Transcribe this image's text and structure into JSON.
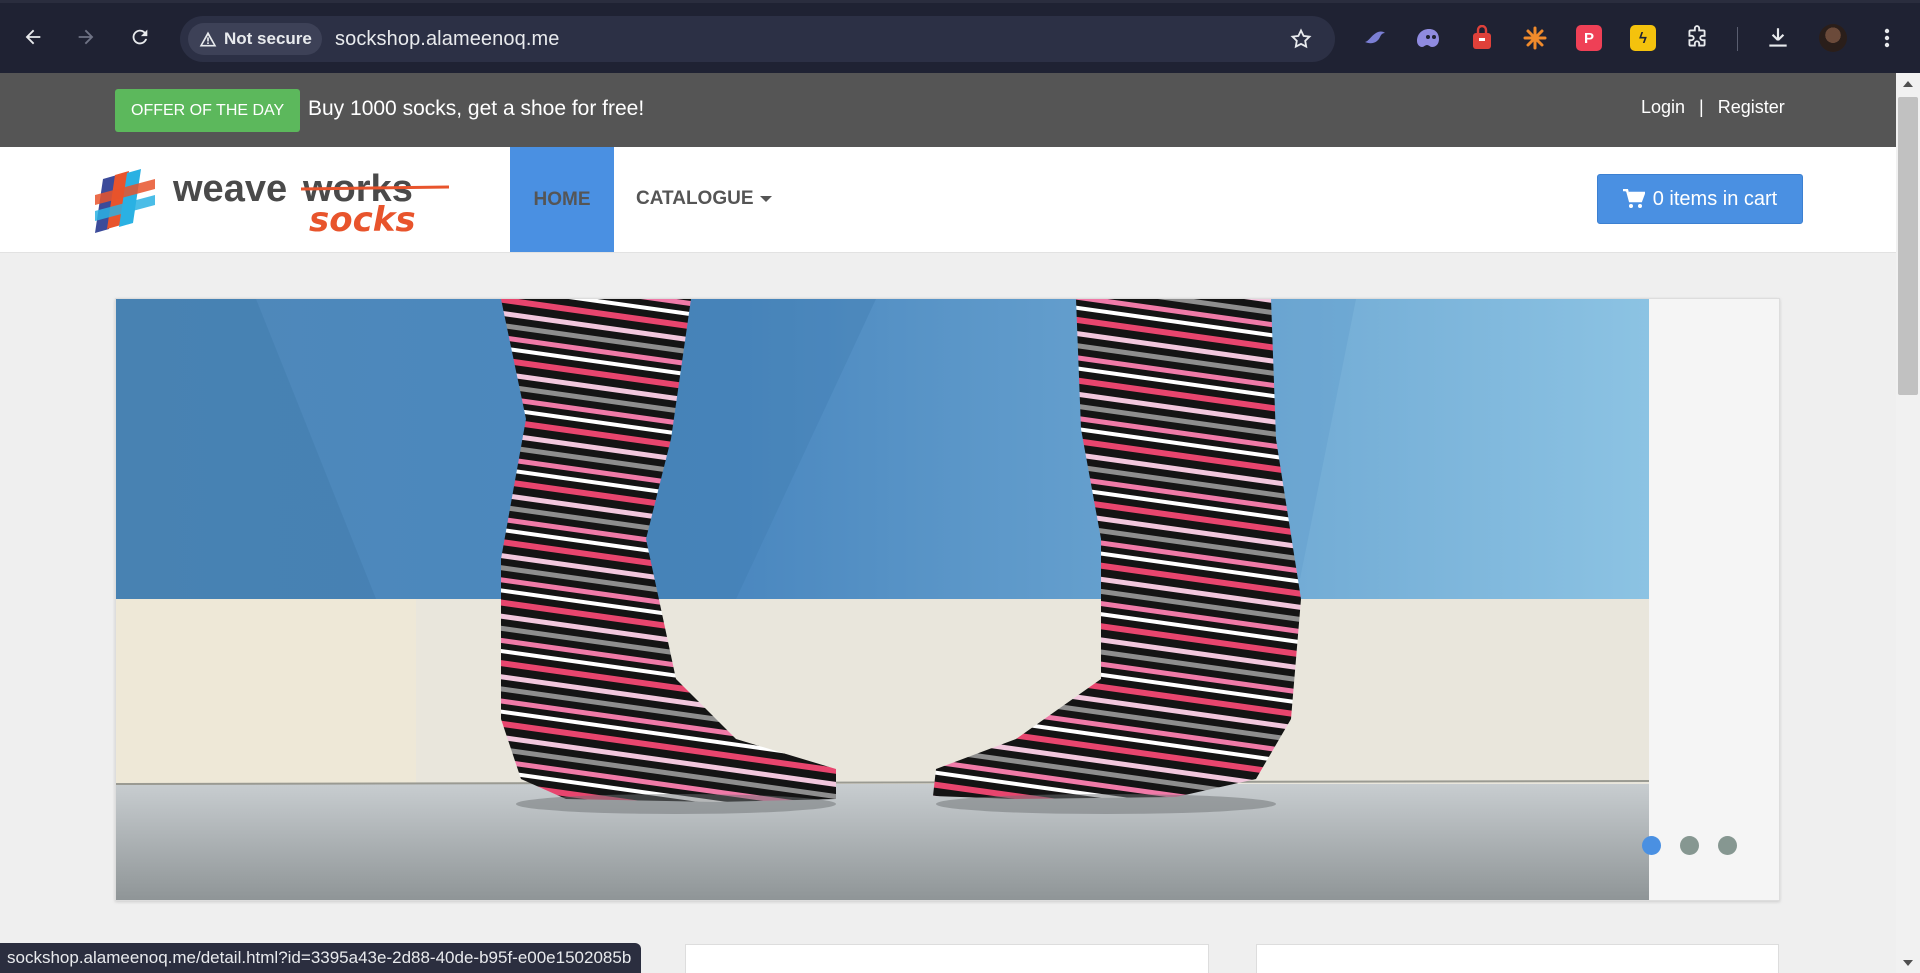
{
  "browser": {
    "security_label": "Not secure",
    "url": "sockshop.alameenoq.me",
    "status_url": "sockshop.alameenoq.me/detail.html?id=3395a43e-2d88-40de-b95f-e00e1502085b",
    "extensions": [
      {
        "name": "extension-bird-icon",
        "color": "#7b7fd4"
      },
      {
        "name": "extension-ghost-icon",
        "color": "#8f8be0"
      },
      {
        "name": "extension-bag-icon",
        "color": "#e0413a"
      },
      {
        "name": "extension-spark-icon",
        "color": "#f08a2b"
      },
      {
        "name": "extension-pocket-icon",
        "color": "#ef4056"
      },
      {
        "name": "extension-bolt-icon",
        "color": "#f4c20d"
      }
    ]
  },
  "topbar": {
    "offer_badge": "OFFER OF THE DAY",
    "offer_text": "Buy 1000 socks, get a shoe for free!",
    "login": "Login",
    "separator": "|",
    "register": "Register"
  },
  "navbar": {
    "logo_text_main": "weave",
    "logo_text_works": "works",
    "logo_text_socks": "socks",
    "home": "HOME",
    "catalogue": "CATALOGUE",
    "cart": "0 items in cart"
  },
  "carousel": {
    "slide_count": 3,
    "active_index": 0
  },
  "colors": {
    "brand_blue": "#4a90e2",
    "offer_green": "#5cb85c",
    "topbar_gray": "#555555"
  }
}
